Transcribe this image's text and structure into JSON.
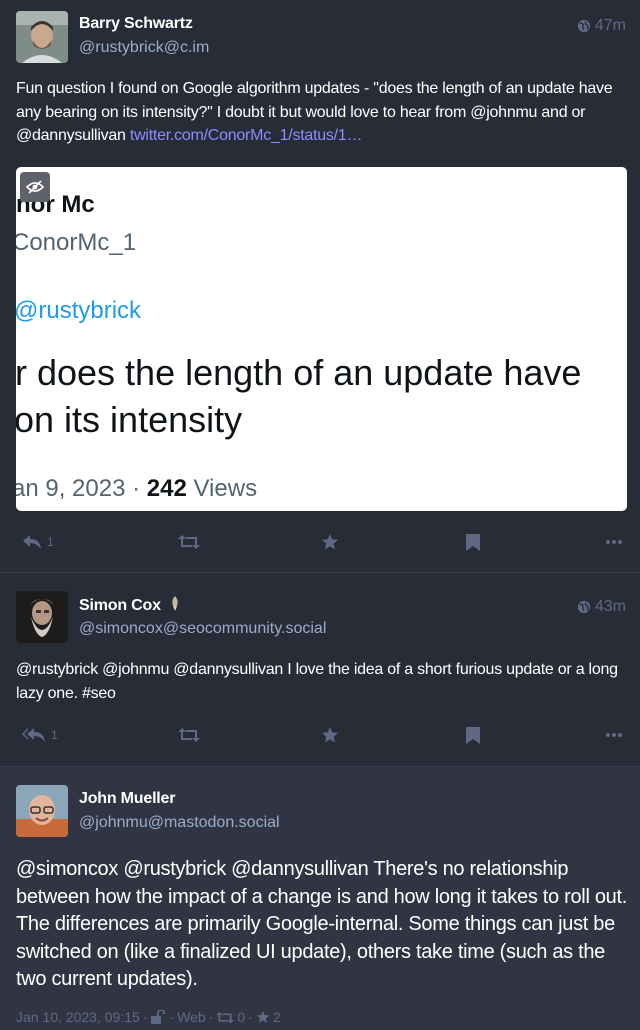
{
  "posts": [
    {
      "author": "Barry Schwartz",
      "handle": "@rustybrick@c.im",
      "time": "47m",
      "text_before_link": "Fun question I found on Google algorithm updates - \"does the length of an update have any bearing on its intensity?\" I doubt it but would love to hear from @johnmu and or @dannysullivan ",
      "link": "twitter.com/ConorMc_1/status/1…",
      "reply_count": "1",
      "media": {
        "name_partial": "nor Mc",
        "handle_partial": "ConorMc_1",
        "mention": "@rustybrick",
        "line1": "r does the length of an update have",
        "line2": "on its intensity",
        "date_partial": "an 9, 2023 · ",
        "views_count": "242",
        "views_label": "Views"
      }
    },
    {
      "author": "Simon Cox",
      "handle": "@simoncox@seocommunity.social",
      "time": "43m",
      "text": "@rustybrick @johnmu @dannysullivan I love the idea of a short furious update or a long lazy one. #seo",
      "reply_count": "1"
    },
    {
      "author": "John Mueller",
      "handle": "@johnmu@mastodon.social",
      "text": "@simoncox @rustybrick @dannysullivan There's no relationship between how the impact of a change is and how long it takes to roll out. The differences are primarily Google-internal. Some things can just be switched on (like a finalized UI update), others take time (such as the two current updates).",
      "date": "Jan 10, 2023, 09:15",
      "app": "Web",
      "boosts": "0",
      "favs": "2"
    }
  ],
  "icons": [
    "globe-icon",
    "reply-icon",
    "boost-icon",
    "star-icon",
    "bookmark-icon",
    "ellipsis-icon",
    "eye-slash-icon",
    "unlock-icon"
  ],
  "colors": {
    "background": "#282c37",
    "link": "#8c8dff",
    "muted": "#606984",
    "handle": "#9baec8"
  }
}
